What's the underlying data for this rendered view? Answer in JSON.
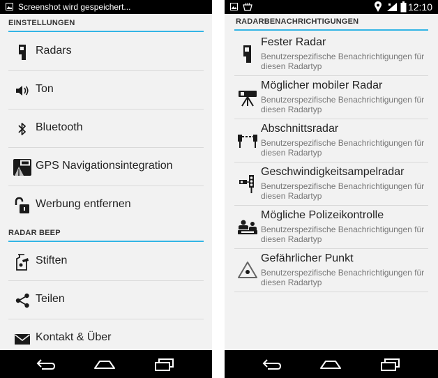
{
  "left_screen": {
    "status_text": "Screenshot wird gespeichert...",
    "section1": "EINSTELLUNGEN",
    "settings": [
      {
        "label": "Radars",
        "icon": "radar-camera-icon"
      },
      {
        "label": "Ton",
        "icon": "speaker-icon"
      },
      {
        "label": "Bluetooth",
        "icon": "bluetooth-icon"
      },
      {
        "label": "GPS Navigationsintegration",
        "icon": "gps-navigation-icon"
      },
      {
        "label": "Werbung entfernen",
        "icon": "unlock-icon"
      }
    ],
    "section2": "RADAR BEEP",
    "app_items": [
      {
        "label": "Stiften",
        "icon": "donate-icon"
      },
      {
        "label": "Teilen",
        "icon": "share-icon"
      },
      {
        "label": "Kontakt & Über",
        "icon": "mail-icon"
      }
    ]
  },
  "right_screen": {
    "clock": "12:10",
    "section": "RADARBENACHRICHTIGUNGEN",
    "radar_types": [
      {
        "title": "Fester Radar",
        "subtitle": "Benutzerspezifische Benachrichtigungen für diesen Radartyp",
        "icon": "fixed-radar-icon"
      },
      {
        "title": "Möglicher mobiler Radar",
        "subtitle": "Benutzerspezifische Benachrichtigungen für diesen Radartyp",
        "icon": "mobile-radar-icon"
      },
      {
        "title": "Abschnittsradar",
        "subtitle": "Benutzerspezifische Benachrichtigungen für diesen Radartyp",
        "icon": "section-radar-icon"
      },
      {
        "title": "Geschwindigkeitsampelradar",
        "subtitle": "Benutzerspezifische Benachrichtigungen für diesen Radartyp",
        "icon": "traffic-light-radar-icon"
      },
      {
        "title": "Mögliche Polizeikontrolle",
        "subtitle": "Benutzerspezifische Benachrichtigungen für diesen Radartyp",
        "icon": "police-control-icon"
      },
      {
        "title": "Gefährlicher Punkt",
        "subtitle": "Benutzerspezifische Benachrichtigungen für diesen Radartyp",
        "icon": "danger-point-icon"
      }
    ]
  },
  "colors": {
    "accent": "#33b5e5",
    "background": "#f2f2f2",
    "bars": "#000000"
  }
}
